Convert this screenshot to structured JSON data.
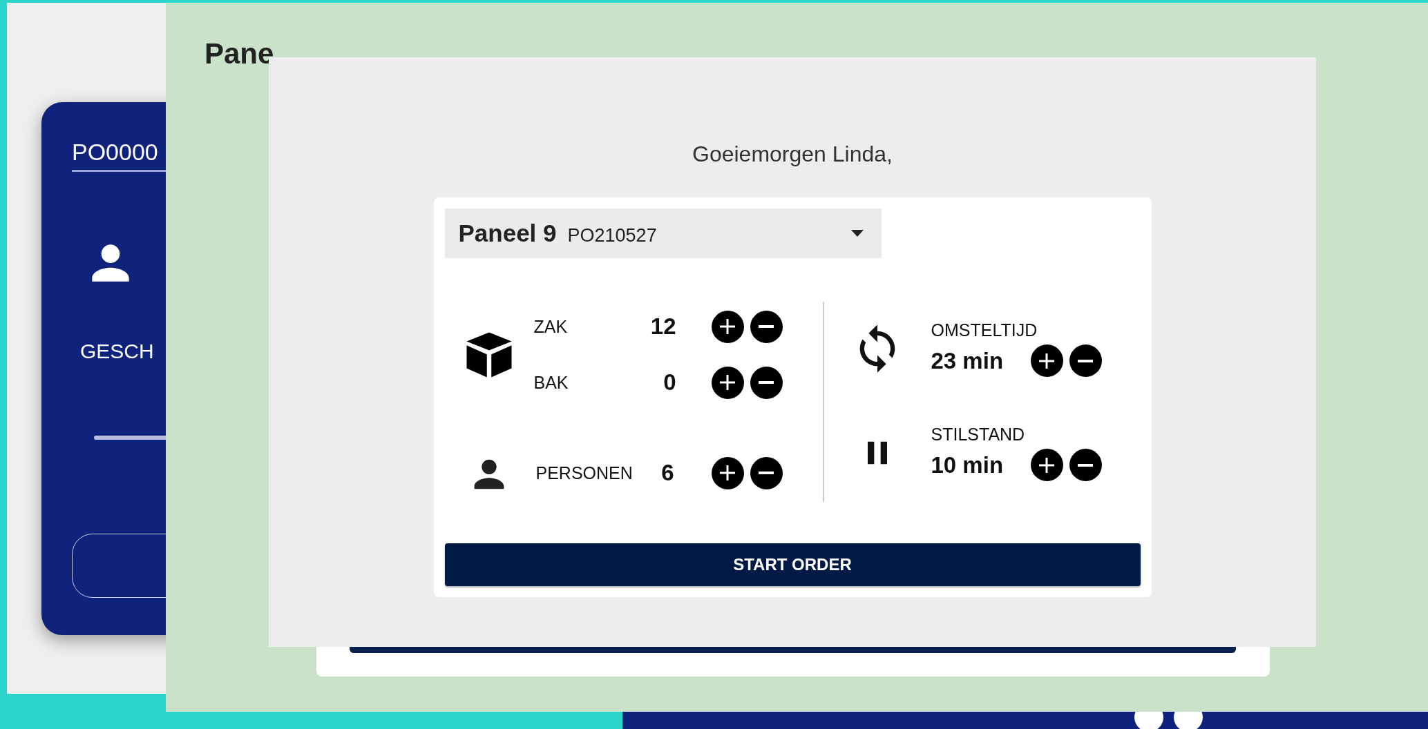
{
  "back_card": {
    "order_field": "PO0000",
    "status": "GESCH"
  },
  "back_panel": {
    "title": "Pane"
  },
  "modal": {
    "greeting": "Goeiemorgen Linda,",
    "product": {
      "title": "Paneel 9",
      "order": "PO210527"
    },
    "quantities": [
      {
        "label": "ZAK",
        "value": "12"
      },
      {
        "label": "BAK",
        "value": "0"
      }
    ],
    "staff": {
      "label": "PERSONEN",
      "value": "6"
    },
    "times": [
      {
        "kind": "changeover",
        "label": "OMSTELTIJD",
        "value": "23 min"
      },
      {
        "kind": "downtime",
        "label": "STILSTAND",
        "value": "10 min"
      }
    ],
    "start_button": "START ORDER"
  }
}
